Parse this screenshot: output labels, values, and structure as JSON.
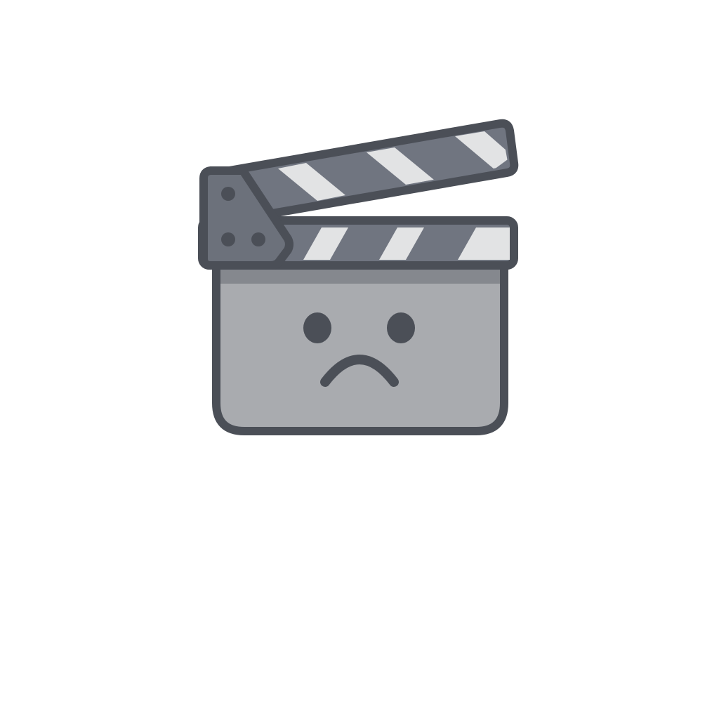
{
  "illustration": {
    "icon": "sad-clapperboard-icon",
    "mood": "sad",
    "colors": {
      "background": "#ffffff",
      "outline": "#4b4f57",
      "body": "#a9abaf",
      "body_band": "#85888e",
      "stick": "#707580",
      "stripe_light": "#e2e3e4",
      "hinge": "#6c717b",
      "hinge_dot": "#4b4f57",
      "face": "#4b4f57"
    }
  }
}
